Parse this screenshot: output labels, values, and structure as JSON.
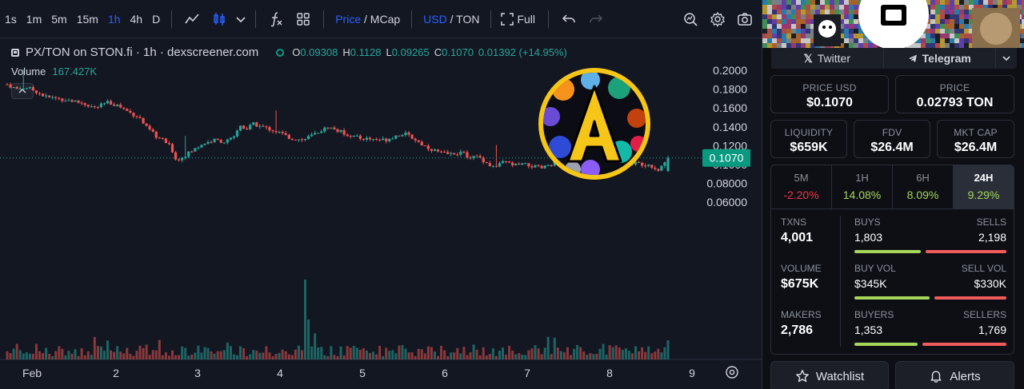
{
  "toolbar": {
    "timeframes": [
      "1s",
      "1m",
      "5m",
      "15m",
      "1h",
      "4h",
      "D"
    ],
    "active_timeframe": "1h",
    "price_label": "Price",
    "mcap_label": "MCap",
    "usd_label": "USD",
    "ton_label": "TON",
    "full_label": "Full"
  },
  "legend": {
    "title": "PX/TON on STON.fi · 1h · dexscreener.com",
    "o_label": "O",
    "o": "0.09308",
    "h_label": "H",
    "h": "0.1128",
    "l_label": "L",
    "l": "0.09265",
    "c_label": "C",
    "c": "0.1070",
    "change": "0.01392 (+14.95%)",
    "volume_label": "Volume",
    "volume": "167.427K"
  },
  "chart_data": {
    "type": "candlestick",
    "x_ticks": [
      "Feb",
      "2",
      "3",
      "4",
      "5",
      "6",
      "7",
      "8",
      "9"
    ],
    "y_ticks": [
      "0.2000",
      "0.1800",
      "0.1600",
      "0.1400",
      "0.1200",
      "0.1000",
      "0.08000",
      "0.06000"
    ],
    "ylim": [
      0.06,
      0.2
    ],
    "last_price": "0.1070",
    "close_path": [
      [
        0.0,
        0.185
      ],
      [
        0.15,
        0.18
      ],
      [
        0.3,
        0.182
      ],
      [
        0.45,
        0.178
      ],
      [
        0.6,
        0.172
      ],
      [
        0.8,
        0.17
      ],
      [
        1.0,
        0.168
      ],
      [
        1.2,
        0.165
      ],
      [
        1.4,
        0.16
      ],
      [
        1.6,
        0.166
      ],
      [
        1.75,
        0.163
      ],
      [
        1.95,
        0.155
      ],
      [
        2.1,
        0.15
      ],
      [
        2.2,
        0.14
      ],
      [
        2.3,
        0.134
      ],
      [
        2.4,
        0.128
      ],
      [
        2.5,
        0.125
      ],
      [
        2.6,
        0.118
      ],
      [
        2.7,
        0.103
      ],
      [
        2.8,
        0.109
      ],
      [
        2.95,
        0.115
      ],
      [
        3.1,
        0.122
      ],
      [
        3.3,
        0.126
      ],
      [
        3.45,
        0.124
      ],
      [
        3.6,
        0.128
      ],
      [
        3.7,
        0.142
      ],
      [
        3.8,
        0.137
      ],
      [
        3.9,
        0.143
      ],
      [
        4.05,
        0.14
      ],
      [
        4.2,
        0.137
      ],
      [
        4.35,
        0.133
      ],
      [
        4.5,
        0.128
      ],
      [
        4.7,
        0.126
      ],
      [
        4.9,
        0.133
      ],
      [
        5.1,
        0.14
      ],
      [
        5.25,
        0.136
      ],
      [
        5.4,
        0.132
      ],
      [
        5.6,
        0.128
      ],
      [
        5.8,
        0.127
      ],
      [
        6.0,
        0.126
      ],
      [
        6.15,
        0.13
      ],
      [
        6.3,
        0.133
      ],
      [
        6.45,
        0.128
      ],
      [
        6.6,
        0.121
      ],
      [
        6.75,
        0.116
      ],
      [
        6.9,
        0.112
      ],
      [
        7.05,
        0.111
      ],
      [
        7.2,
        0.113
      ],
      [
        7.35,
        0.108
      ],
      [
        7.5,
        0.108
      ],
      [
        7.65,
        0.1
      ],
      [
        7.75,
        0.097
      ],
      [
        7.9,
        0.103
      ],
      [
        8.05,
        0.099
      ],
      [
        8.2,
        0.1
      ],
      [
        8.35,
        0.098
      ],
      [
        8.5,
        0.096
      ],
      [
        8.65,
        0.101
      ],
      [
        8.8,
        0.103
      ],
      [
        8.95,
        0.099
      ],
      [
        9.1,
        0.104
      ],
      [
        9.25,
        0.1
      ],
      [
        9.4,
        0.098
      ],
      [
        9.55,
        0.101
      ],
      [
        9.7,
        0.1
      ],
      [
        9.9,
        0.102
      ],
      [
        10.05,
        0.101
      ],
      [
        10.2,
        0.1
      ],
      [
        10.35,
        0.094
      ],
      [
        10.5,
        0.107
      ]
    ],
    "volume_note": "volume bars below price"
  },
  "info": {
    "twitter_label": "Twitter",
    "telegram_label": "Telegram",
    "price_usd_label": "PRICE USD",
    "price_usd": "$0.1070",
    "price_label": "PRICE",
    "price_ton": "0.02793 TON",
    "liquidity_label": "LIQUIDITY",
    "liquidity": "$659K",
    "fdv_label": "FDV",
    "fdv": "$26.4M",
    "mktcap_label": "MKT CAP",
    "mktcap": "$26.4M",
    "periods": [
      {
        "label": "5M",
        "value": "-2.20%",
        "dir": "neg"
      },
      {
        "label": "1H",
        "value": "14.08%",
        "dir": "pos"
      },
      {
        "label": "6H",
        "value": "8.09%",
        "dir": "pos"
      },
      {
        "label": "24H",
        "value": "9.29%",
        "dir": "pos"
      }
    ],
    "txns_label": "TXNS",
    "txns": "4,001",
    "buys_label": "BUYS",
    "buys": "1,803",
    "sells_label": "SELLS",
    "sells": "2,198",
    "buys_fraction": 0.45,
    "volume_label": "VOLUME",
    "volume": "$675K",
    "buyvol_label": "BUY VOL",
    "buyvol": "$345K",
    "sellvol_label": "SELL VOL",
    "sellvol": "$330K",
    "buyvol_fraction": 0.51,
    "makers_label": "MAKERS",
    "makers": "2,786",
    "buyers_label": "BUYERS",
    "buyers": "1,353",
    "sellers_label": "SELLERS",
    "sellers": "1,769",
    "buyers_fraction": 0.43,
    "watchlist_label": "Watchlist",
    "alerts_label": "Alerts"
  },
  "colors": {
    "up": "#26a69a",
    "down": "#ef5350",
    "accent": "#2962ff",
    "positive": "#a5d65a",
    "negative": "#f23645"
  }
}
